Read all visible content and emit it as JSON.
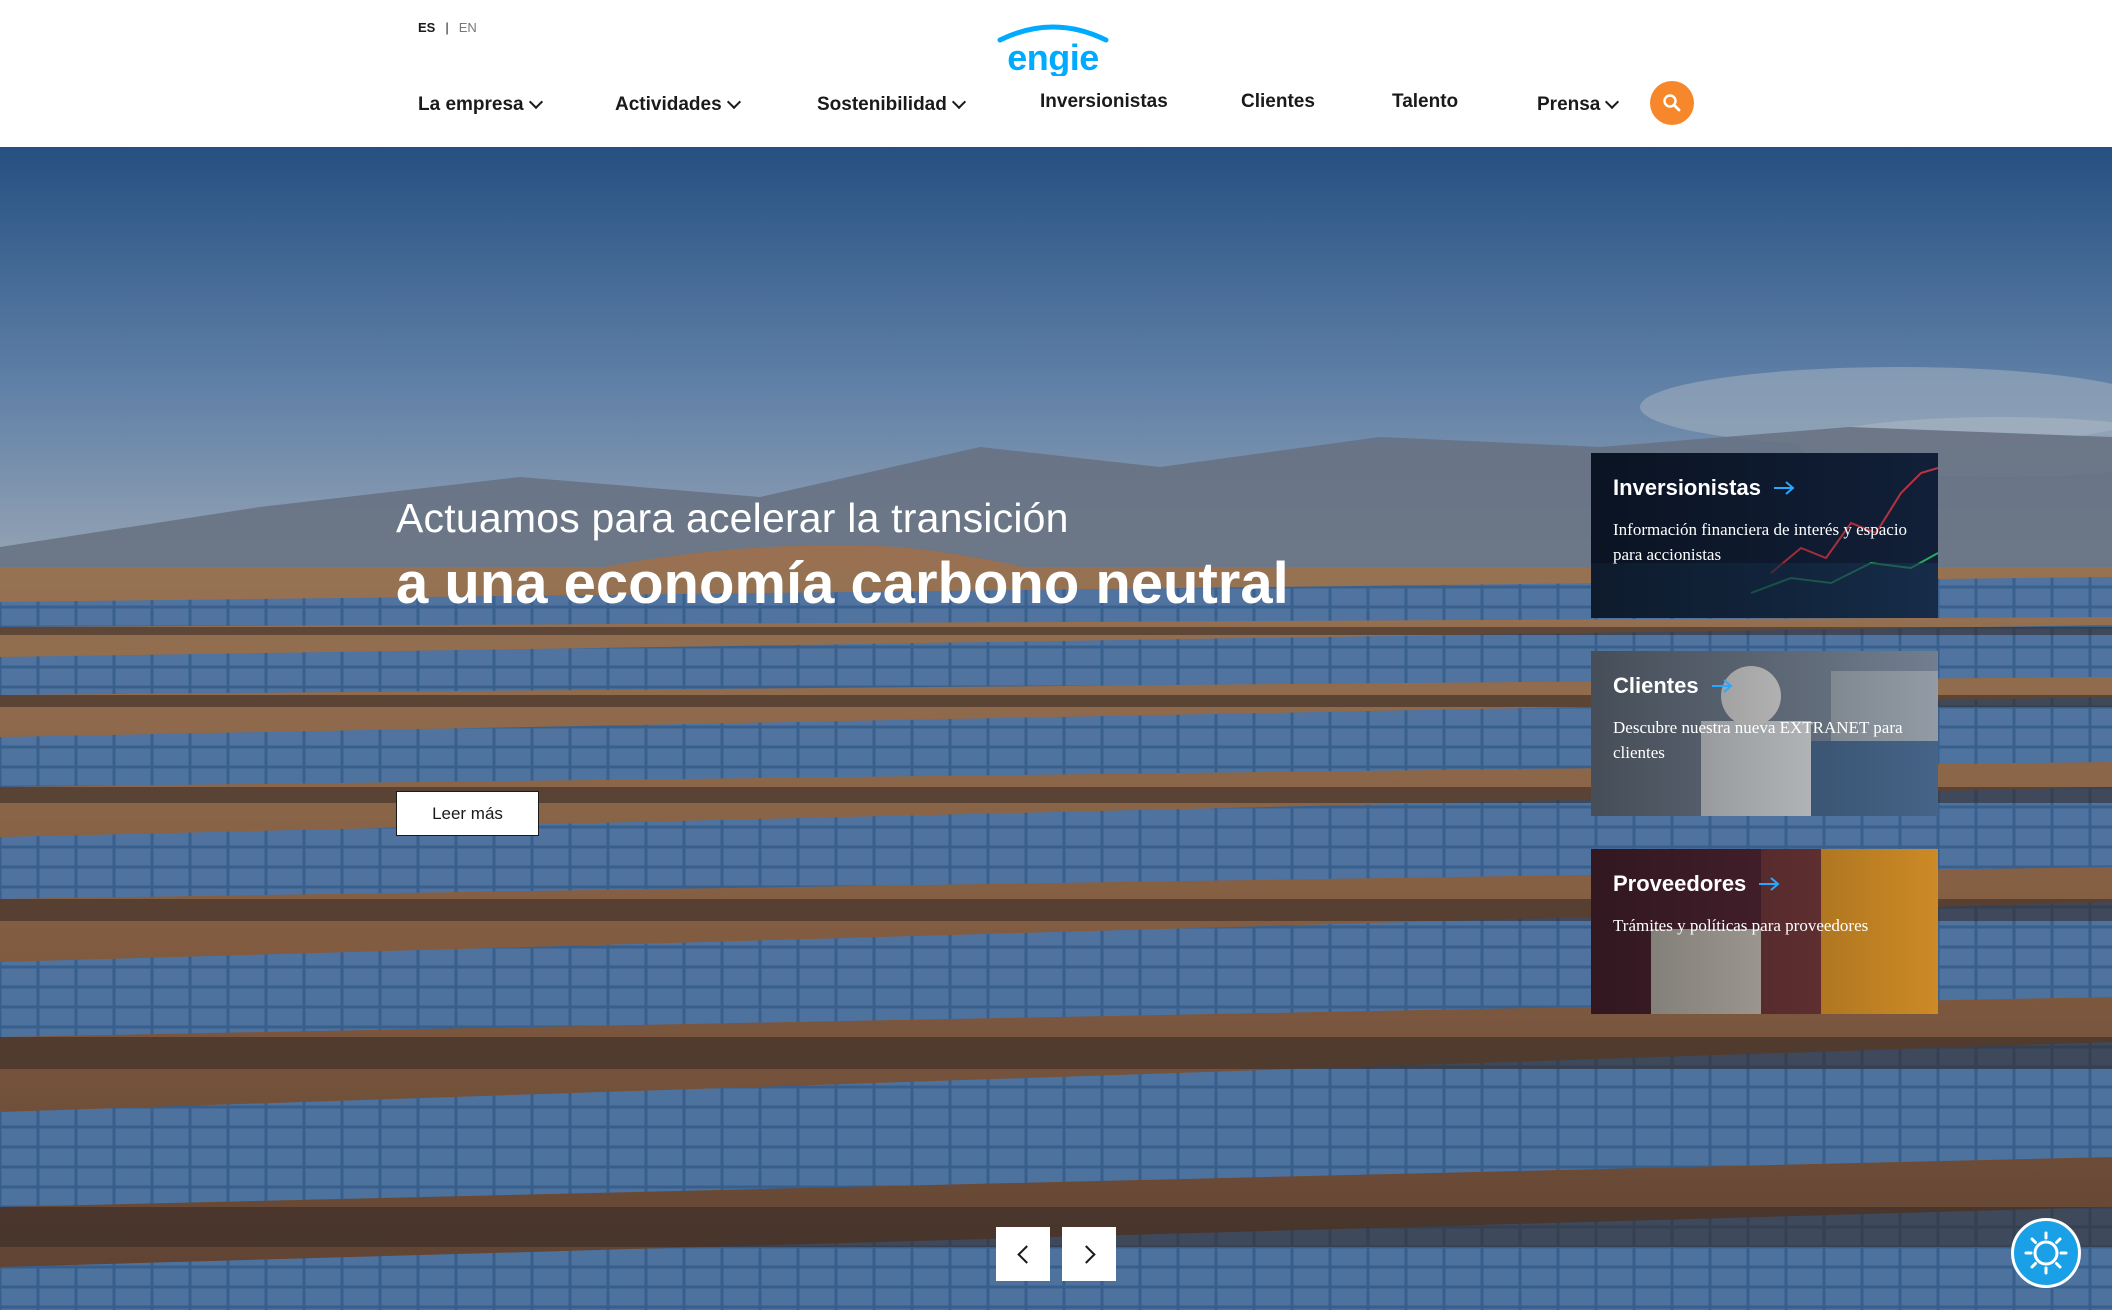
{
  "header": {
    "languages": {
      "active": "ES",
      "separator": "|",
      "other": "EN"
    },
    "logo_text": "engie",
    "nav": [
      {
        "label": "La empresa",
        "dropdown": true
      },
      {
        "label": "Actividades",
        "dropdown": true
      },
      {
        "label": "Sostenibilidad",
        "dropdown": true
      },
      {
        "label": "Inversionistas",
        "dropdown": false
      },
      {
        "label": "Clientes",
        "dropdown": false
      },
      {
        "label": "Talento",
        "dropdown": false
      },
      {
        "label": "Prensa",
        "dropdown": true
      }
    ],
    "search_icon": "search-icon"
  },
  "hero": {
    "line1": "Actuamos para acelerar la transición",
    "line2": "a una economía carbono neutral",
    "cta": "Leer más"
  },
  "cards": [
    {
      "title": "Inversionistas",
      "description": "Información financiera de interés y espacio para accionistas"
    },
    {
      "title": "Clientes",
      "description": "Descubre nuestra nueva EXTRANET para clientes"
    },
    {
      "title": "Proveedores",
      "description": "Trámites y políticas para proveedores"
    }
  ],
  "colors": {
    "brand_blue": "#00aaff",
    "accent_orange": "#f6872b",
    "helper_blue": "#1aa0e6"
  },
  "carousel": {
    "prev_icon": "chevron-left-icon",
    "next_icon": "chevron-right-icon"
  },
  "helper_icon": "lightbulb-icon"
}
